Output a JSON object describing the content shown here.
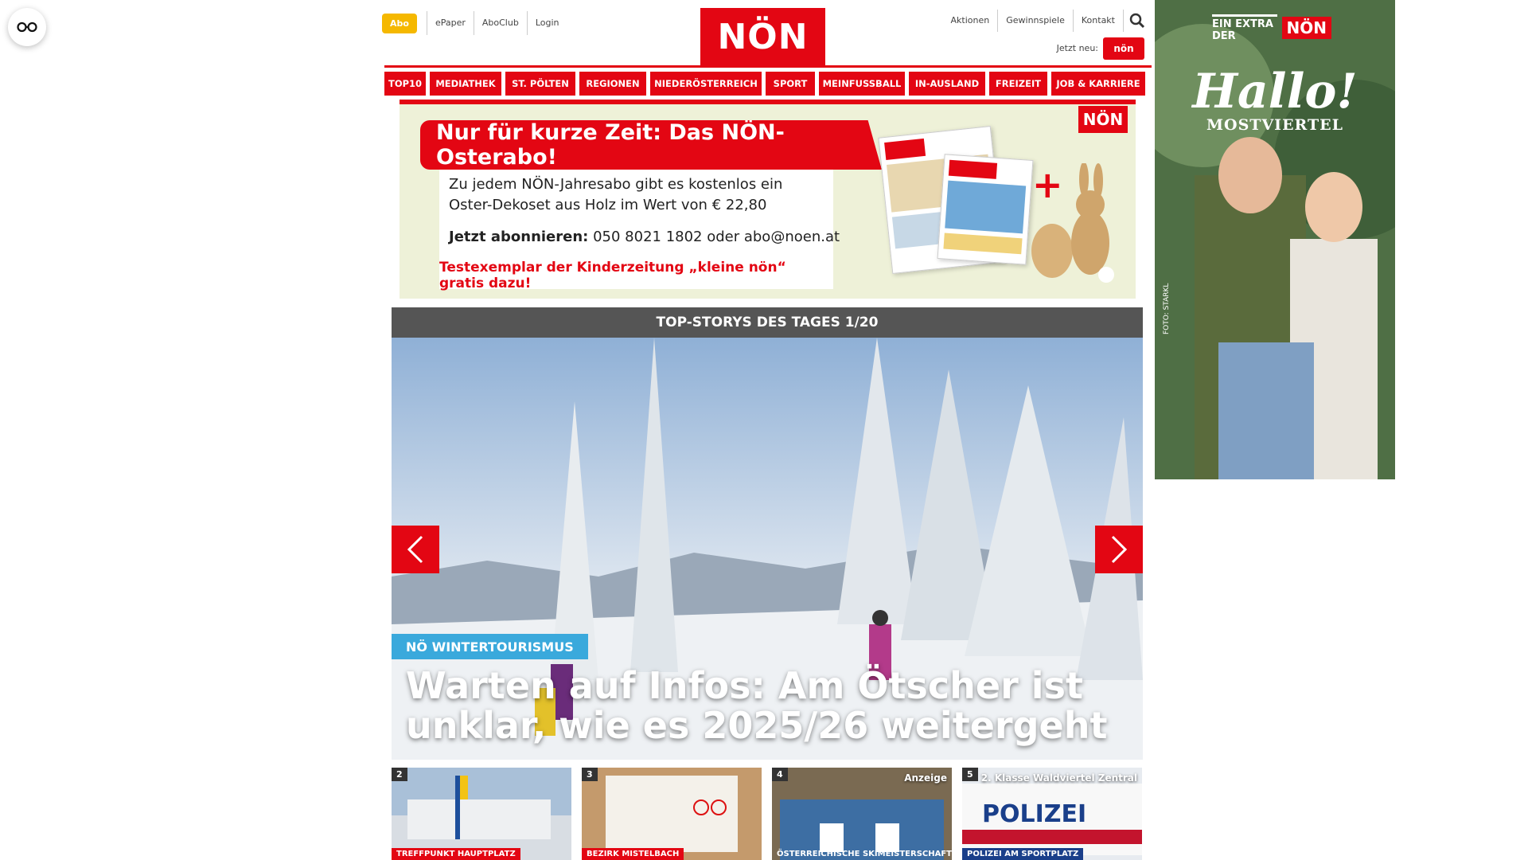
{
  "reader": {
    "icon": "glasses-icon"
  },
  "topbar": {
    "abo": "Abo",
    "links": [
      "ePaper",
      "AboClub",
      "Login"
    ],
    "logo": "NÖN",
    "right_links": [
      "Aktionen",
      "Gewinnspiele",
      "Kontakt"
    ],
    "jetzt_neu": "Jetzt neu:",
    "kleine_logo": "nön"
  },
  "nav": [
    "TOP10",
    "MEDIATHEK",
    "ST. PÖLTEN",
    "REGIONEN",
    "NIEDERÖSTERREICH",
    "SPORT",
    "MEINFUSSBALL",
    "IN-AUSLAND",
    "FREIZEIT",
    "JOB & KARRIERE"
  ],
  "banner": {
    "headline": "Nur für kurze Zeit: Das NÖN-Osterabo!",
    "line1": "Zu jedem NÖN-Jahresabo gibt es kostenlos ein",
    "line2": "Oster-Dekoset aus Holz im Wert von € 22,80",
    "cta_label": "Jetzt abonnieren:",
    "cta_value": " 050 8021 1802 oder abo@noen.at",
    "note": "Testexemplar der Kinderzeitung „kleine nön“ gratis dazu!",
    "logo": "NÖN",
    "plus": "+"
  },
  "stories": {
    "header": "TOP-STORYS DES TAGES 1/20",
    "tag": "NÖ WINTERTOURISMUS",
    "title": "Warten auf Infos: Am Ötscher ist unklar, wie es 2025/26 weitergeht"
  },
  "thumbs": [
    {
      "num": "2",
      "tag": "TREFFPUNKT HAUPTPLATZ",
      "right": "",
      "bg": "#8aa7c6"
    },
    {
      "num": "3",
      "tag": "BEZIRK MISTELBACH",
      "right": "",
      "bg": "#b88b5e"
    },
    {
      "num": "4",
      "tag": "ÖSTERREICHISCHE SKIMEISTERSCHAFT",
      "right": "Anzeige",
      "bg": "#3d6ea3"
    },
    {
      "num": "5",
      "tag": "POLIZEI AM SPORTPLATZ",
      "right": "2. Klasse Waldviertel Zentral",
      "bg": "#cfd5de"
    }
  ],
  "sidead": {
    "extra": "EIN EXTRA DER",
    "logo": "NÖN",
    "hallo": "Hallo!",
    "sub": "MOSTVIERTEL",
    "foto": "FOTO: STARKL"
  }
}
